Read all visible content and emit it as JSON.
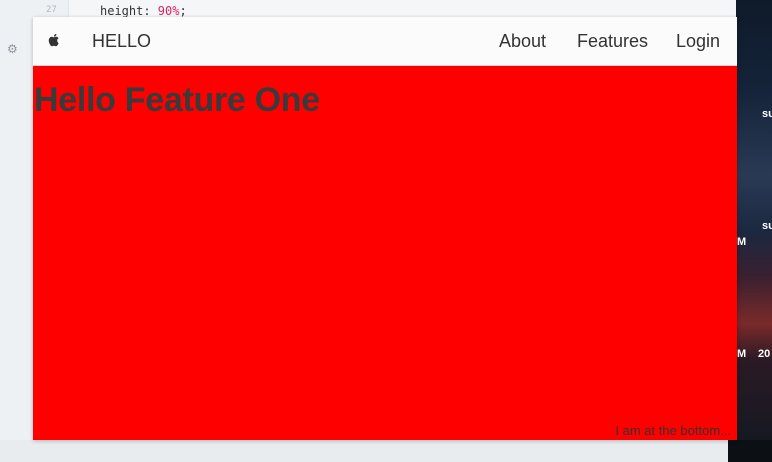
{
  "editor": {
    "line_number": "27",
    "code_property": "height: ",
    "code_value": "90%",
    "code_end": ";"
  },
  "background_strip": {
    "texts": [
      "su",
      "su",
      "M",
      "M",
      "20"
    ]
  },
  "navbar": {
    "brand": "HELLO",
    "links": [
      "About",
      "Features",
      "Login"
    ],
    "logo_icon": "apple-icon"
  },
  "page": {
    "heading": "Hello Feature One",
    "footer_note": "I am at the bottom...",
    "background_color": "#ff0000"
  }
}
